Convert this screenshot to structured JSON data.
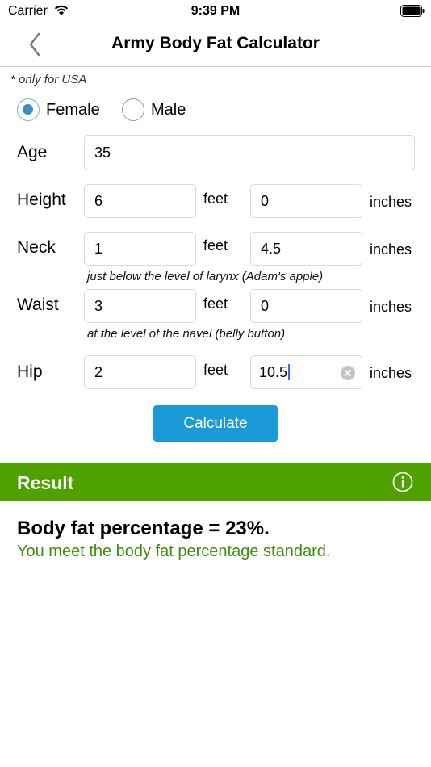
{
  "status_bar": {
    "carrier": "Carrier",
    "time": "9:39 PM"
  },
  "nav": {
    "title": "Army Body Fat Calculator"
  },
  "note": "* only for USA",
  "gender": {
    "options": [
      "Female",
      "Male"
    ],
    "selected": "Female"
  },
  "form": {
    "age": {
      "label": "Age",
      "value": "35"
    },
    "height": {
      "label": "Height",
      "feet": "6",
      "inches": "0"
    },
    "neck": {
      "label": "Neck",
      "feet": "1",
      "inches": "4.5",
      "hint": "just below the level of larynx (Adam's apple)"
    },
    "waist": {
      "label": "Waist",
      "feet": "3",
      "inches": "0",
      "hint": "at the level of the navel (belly button)"
    },
    "hip": {
      "label": "Hip",
      "feet": "2",
      "inches": "10.5"
    },
    "feet_unit": "feet",
    "inches_unit": "inches"
  },
  "calculate_label": "Calculate",
  "result": {
    "header": "Result",
    "main": "Body fat percentage = 23%.",
    "status": "You meet the body fat percentage standard."
  },
  "colors": {
    "accent": "#1a9ad6",
    "result_bar": "#4fa100",
    "status_text": "#3f8d0d"
  }
}
